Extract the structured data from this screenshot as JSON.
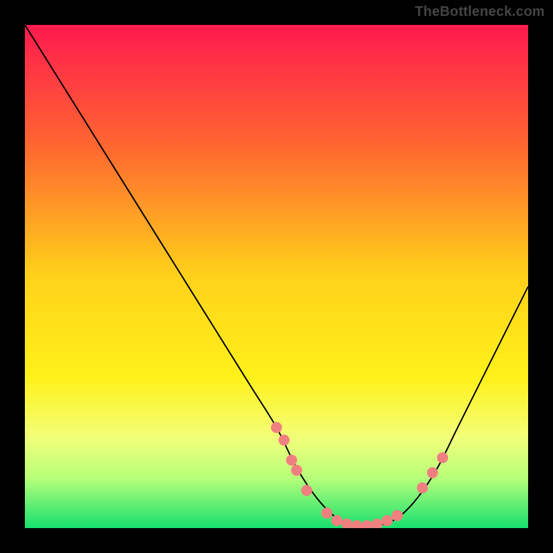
{
  "watermark": "TheBottleneck.com",
  "chart_data": {
    "type": "line",
    "title": "",
    "xlabel": "",
    "ylabel": "",
    "xlim": [
      0,
      100
    ],
    "ylim": [
      0,
      100
    ],
    "grid": false,
    "legend": null,
    "background_gradient_stops": [
      {
        "offset": 0.0,
        "color": "#ff1a4f"
      },
      {
        "offset": 0.25,
        "color": "#ff6a2f"
      },
      {
        "offset": 0.5,
        "color": "#ffd21a"
      },
      {
        "offset": 0.7,
        "color": "#fff11a"
      },
      {
        "offset": 0.82,
        "color": "#f2ff7a"
      },
      {
        "offset": 0.9,
        "color": "#b8ff7a"
      },
      {
        "offset": 1.0,
        "color": "#16e06e"
      }
    ],
    "series": [
      {
        "name": "bottleneck-curve",
        "color": "#000000",
        "x": [
          0,
          5,
          10,
          15,
          20,
          25,
          30,
          35,
          40,
          45,
          50,
          54,
          58,
          62,
          66,
          70,
          74,
          78,
          82,
          86,
          90,
          94,
          98,
          100
        ],
        "y": [
          100,
          92,
          84,
          76,
          68,
          60,
          52,
          44,
          36,
          28,
          20,
          12,
          6,
          2,
          0.5,
          0.5,
          2,
          6,
          12,
          20,
          28,
          36,
          44,
          48
        ]
      }
    ],
    "markers": {
      "color": "#f08080",
      "radius": 1.1,
      "points": [
        {
          "x": 50.0,
          "y": 20.0
        },
        {
          "x": 51.5,
          "y": 17.5
        },
        {
          "x": 53.0,
          "y": 13.5
        },
        {
          "x": 54.0,
          "y": 11.5
        },
        {
          "x": 56.0,
          "y": 7.5
        },
        {
          "x": 60.0,
          "y": 3.0
        },
        {
          "x": 62.0,
          "y": 1.5
        },
        {
          "x": 64.0,
          "y": 0.8
        },
        {
          "x": 66.0,
          "y": 0.5
        },
        {
          "x": 68.0,
          "y": 0.5
        },
        {
          "x": 70.0,
          "y": 0.8
        },
        {
          "x": 72.0,
          "y": 1.5
        },
        {
          "x": 74.0,
          "y": 2.5
        },
        {
          "x": 79.0,
          "y": 8.0
        },
        {
          "x": 81.0,
          "y": 11.0
        },
        {
          "x": 83.0,
          "y": 14.0
        }
      ]
    }
  }
}
